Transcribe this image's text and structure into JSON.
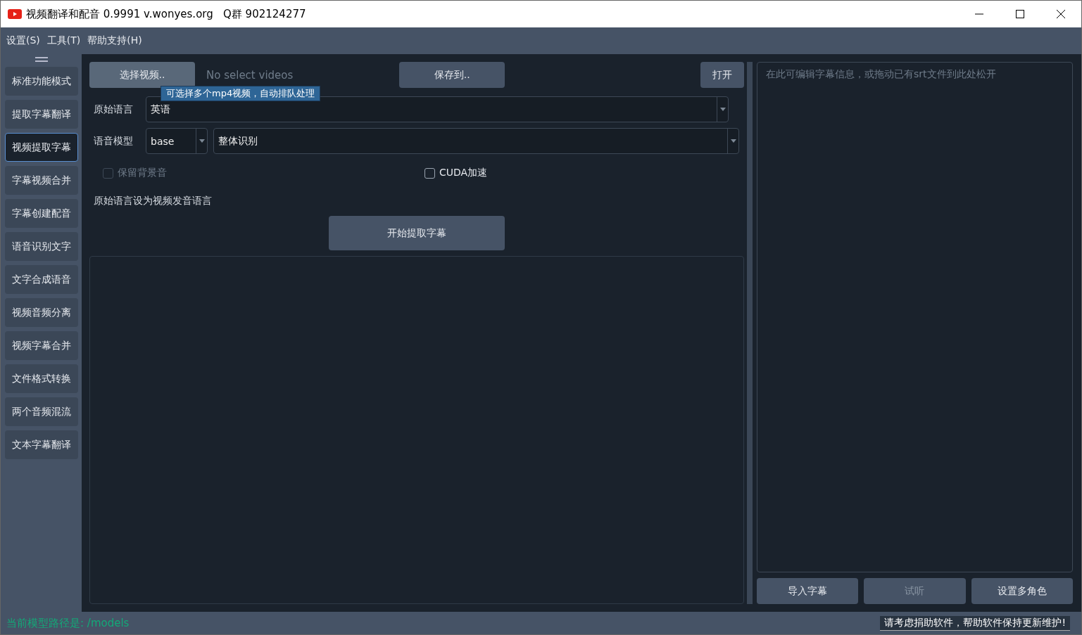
{
  "window": {
    "title": "视频翻译和配音 0.9991 v.wonyes.org   Q群 902124277"
  },
  "menu": [
    "设置(S)",
    "工具(T)",
    "帮助支持(H)"
  ],
  "sidebar": {
    "items": [
      {
        "label": "标准功能模式",
        "selected": false
      },
      {
        "label": "提取字幕翻译",
        "selected": false
      },
      {
        "label": "视频提取字幕",
        "selected": true
      },
      {
        "label": "字幕视频合并",
        "selected": false
      },
      {
        "label": "字幕创建配音",
        "selected": false
      },
      {
        "label": "语音识别文字",
        "selected": false
      },
      {
        "label": "文字合成语音",
        "selected": false
      },
      {
        "label": "视频音频分离",
        "selected": false
      },
      {
        "label": "视频字幕合并",
        "selected": false
      },
      {
        "label": "文件格式转换",
        "selected": false
      },
      {
        "label": "两个音频混流",
        "selected": false
      },
      {
        "label": "文本字幕翻译",
        "selected": false
      }
    ]
  },
  "main": {
    "select_button": "选择视频..",
    "file_status": "No select videos",
    "tooltip": "可选择多个mp4视频，自动排队处理",
    "save_button": "保存到..",
    "open_button": "打开",
    "source_language": {
      "label": "原始语言",
      "value": "英语"
    },
    "model": {
      "label": "语音模型",
      "value": "base",
      "mode": "整体识别"
    },
    "keep_background": {
      "label": "保留背景音",
      "checked": false,
      "disabled": true
    },
    "cuda": {
      "label": "CUDA加速",
      "checked": false,
      "disabled": false
    },
    "hint": "原始语言设为视频发音语言",
    "start_button": "开始提取字幕"
  },
  "editor": {
    "placeholder": "在此可编辑字幕信息，或拖动已有srt文件到此处松开",
    "buttons": [
      {
        "label": "导入字幕",
        "disabled": false
      },
      {
        "label": "试听",
        "disabled": true
      },
      {
        "label": "设置多角色",
        "disabled": false
      }
    ]
  },
  "status_bar": {
    "model_path": "当前模型路径是: /models",
    "donate": "请考虑捐助软件，帮助软件保持更新维护!"
  }
}
